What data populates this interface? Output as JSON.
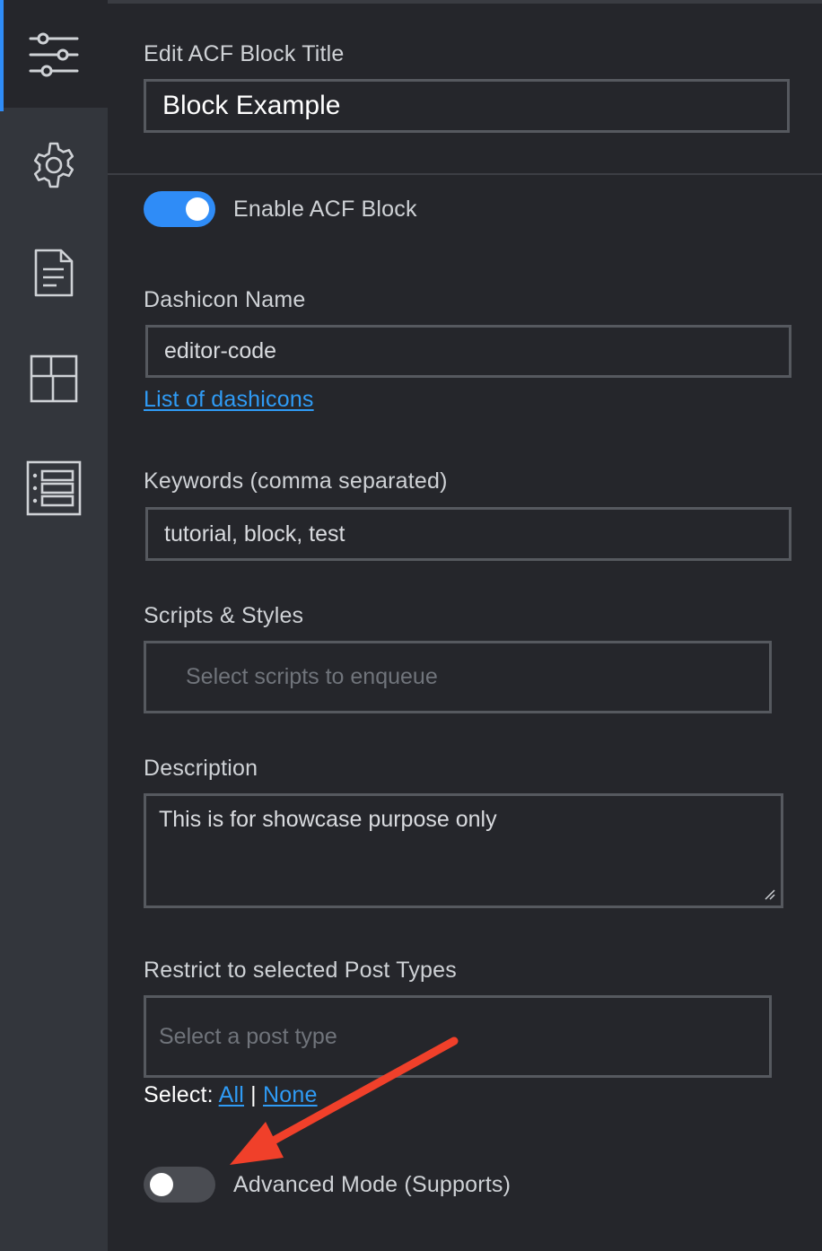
{
  "sidebar": {
    "tabs": [
      {
        "icon": "sliders-icon",
        "active": true
      },
      {
        "icon": "gear-icon",
        "active": false
      },
      {
        "icon": "document-icon",
        "active": false
      },
      {
        "icon": "layout-icon",
        "active": false
      },
      {
        "icon": "list-icon",
        "active": false
      }
    ]
  },
  "block_title": {
    "label": "Edit ACF Block Title",
    "value": "Block Example"
  },
  "enable_block": {
    "label": "Enable ACF Block",
    "checked": true
  },
  "dashicon": {
    "label": "Dashicon Name",
    "value": "editor-code",
    "link_text": "List of dashicons"
  },
  "keywords": {
    "label": "Keywords (comma separated)",
    "value": "tutorial, block, test"
  },
  "scripts": {
    "label": "Scripts & Styles",
    "placeholder": "Select scripts to enqueue"
  },
  "description": {
    "label": "Description",
    "value": "This is for showcase purpose only"
  },
  "post_types": {
    "label": "Restrict to selected Post Types",
    "placeholder": "Select a post type",
    "select_prefix": "Select:",
    "all_link": "All",
    "separator": "|",
    "none_link": "None"
  },
  "advanced_mode": {
    "label": "Advanced Mode (Supports)",
    "checked": false
  },
  "colors": {
    "accent": "#2f8cf7",
    "link": "#2f9bf5",
    "annotation_arrow": "#f0402a",
    "toggle_off": "#4a4c52"
  }
}
